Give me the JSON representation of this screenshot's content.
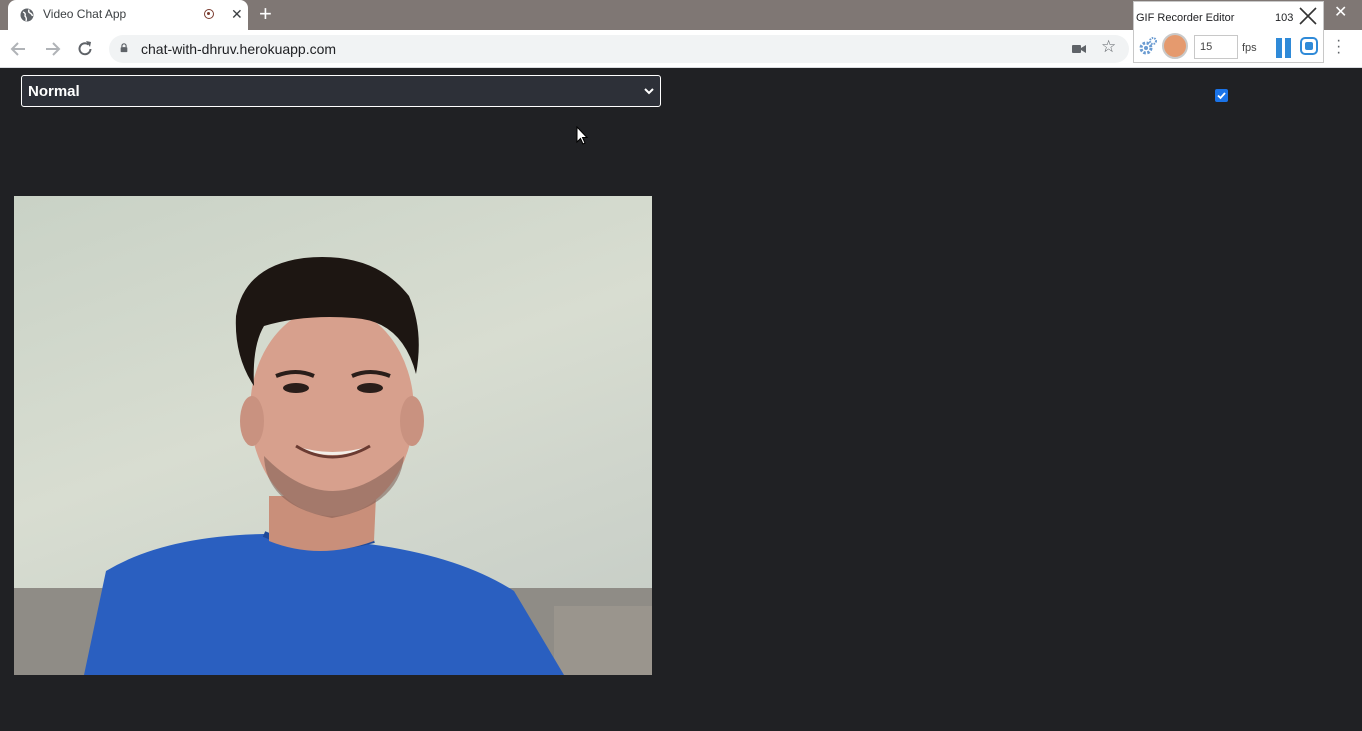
{
  "browser": {
    "tab_title": "Video Chat App",
    "tab_close": "✕",
    "new_tab": "+",
    "window_close": "✕",
    "url": "chat-with-dhruv.herokuapp.com"
  },
  "gif_recorder": {
    "title": "GIF Recorder Editor",
    "frame_count": "103",
    "fps_value": "15",
    "fps_label": "fps",
    "accent": "#2f8ad8"
  },
  "page": {
    "mode_select_value": "Normal",
    "checkbox_checked": true,
    "checkbox_color": "#1a73e8",
    "background": "#202124"
  },
  "icons": [
    "globe-icon",
    "recording-icon",
    "back-icon",
    "forward-icon",
    "reload-icon",
    "lock-icon",
    "camera-icon",
    "star-icon",
    "menu-icon",
    "gear-icon",
    "timer-icon",
    "pause-icon",
    "stop-icon",
    "chevron-down-icon",
    "mouse-cursor-icon"
  ]
}
